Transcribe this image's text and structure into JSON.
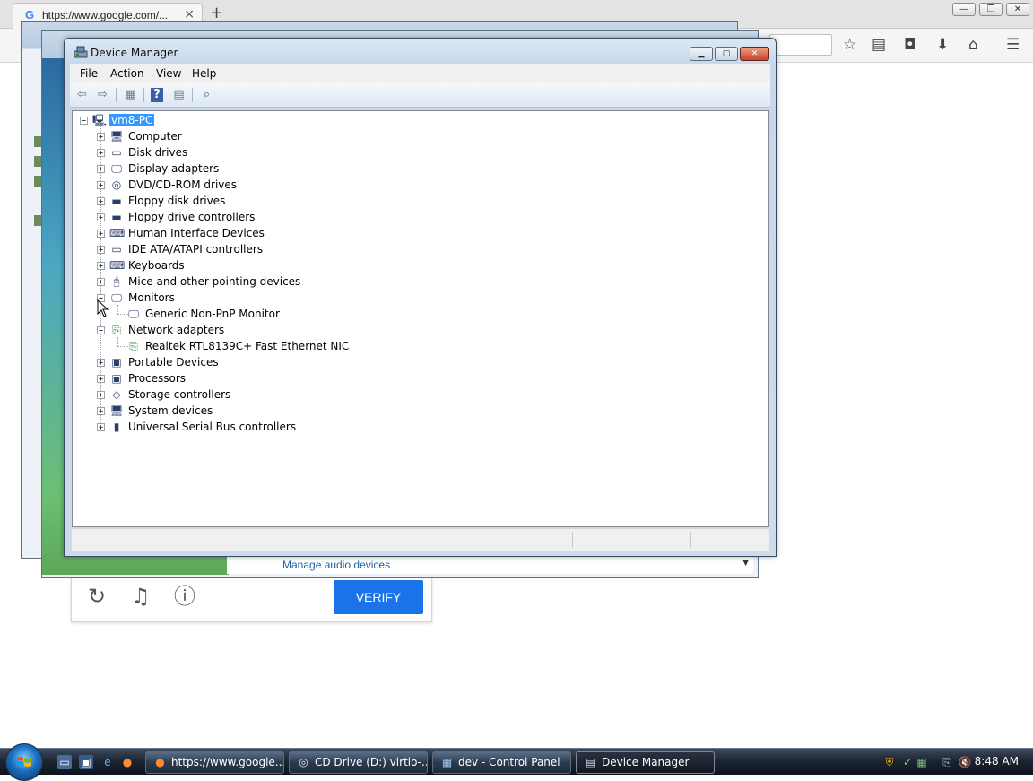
{
  "browser": {
    "tab_title": "https://www.google.com/...",
    "tab_close": "×",
    "new_tab": "+",
    "favicon": "G"
  },
  "captcha": {
    "verify_label": "VERIFY",
    "icons": [
      "reload-icon",
      "headphones-icon",
      "info-icon"
    ]
  },
  "background_window": {
    "manage_audio_link": "Manage audio devices"
  },
  "device_manager": {
    "title": "Device Manager",
    "menu": [
      "File",
      "Action",
      "View",
      "Help"
    ],
    "root": "vm8-PC",
    "categories": [
      {
        "label": "Computer",
        "expanded": false
      },
      {
        "label": "Disk drives",
        "expanded": false
      },
      {
        "label": "Display adapters",
        "expanded": false
      },
      {
        "label": "DVD/CD-ROM drives",
        "expanded": false
      },
      {
        "label": "Floppy disk drives",
        "expanded": false
      },
      {
        "label": "Floppy drive controllers",
        "expanded": false
      },
      {
        "label": "Human Interface Devices",
        "expanded": false
      },
      {
        "label": "IDE ATA/ATAPI controllers",
        "expanded": false
      },
      {
        "label": "Keyboards",
        "expanded": false
      },
      {
        "label": "Mice and other pointing devices",
        "expanded": false
      },
      {
        "label": "Monitors",
        "expanded": true,
        "children": [
          "Generic Non-PnP Monitor"
        ]
      },
      {
        "label": "Network adapters",
        "expanded": true,
        "children": [
          "Realtek RTL8139C+ Fast Ethernet NIC"
        ]
      },
      {
        "label": "Portable Devices",
        "expanded": false
      },
      {
        "label": "Processors",
        "expanded": false
      },
      {
        "label": "Storage controllers",
        "expanded": false
      },
      {
        "label": "System devices",
        "expanded": false
      },
      {
        "label": "Universal Serial Bus controllers",
        "expanded": false
      }
    ]
  },
  "taskbar": {
    "tasks": [
      {
        "label": "https://www.google...",
        "icon": "firefox-icon",
        "active": false
      },
      {
        "label": "CD Drive (D:) virtio-...",
        "icon": "cd-drive-icon",
        "active": false
      },
      {
        "label": "dev - Control Panel",
        "icon": "control-panel-icon",
        "active": false
      },
      {
        "label": "Device Manager",
        "icon": "device-manager-icon",
        "active": true
      }
    ],
    "clock": "8:48 AM"
  }
}
